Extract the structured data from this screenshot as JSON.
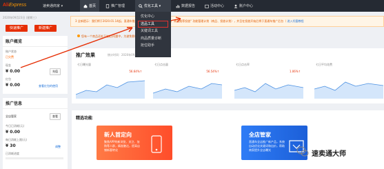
{
  "brand": {
    "logo_main": "Ali",
    "logo_sub": "Express"
  },
  "switcher": "速卖通商家 ▾",
  "nav": {
    "home": "首页",
    "promo_mgmt": "推广管理",
    "optimize": "优化工具 ▾",
    "data_report": "数据报告",
    "events": "活动中心",
    "account": "账户中心"
  },
  "dropdown": {
    "items": [
      "优化中心",
      "选品工具",
      "关键词工具",
      "商品质量诊断",
      "抢位助手"
    ]
  },
  "notice": {
    "text": "3 全新提示：我们将于2020.01.14起，直通车推广计划内的商品 将逐渐替换为 \"商品推荐投放\" 功能管理计划（商品、投放计划），并且在投放开始后将于直通车推广后台（",
    "link": "进入托管教程",
    "text2": "您有一个商品还处于被拒/问题中，为避免影响推广效果，请尽快处理"
  },
  "left": {
    "date": "2020年09月23日 (星期三)",
    "btn_promote": "快速推广",
    "btn_new": "新建推广",
    "overview_title": "账户概览",
    "status_label": "账户状态",
    "status_value": "已欠费",
    "cash_label": "现金",
    "cash_value": "¥ 0.00",
    "recharge": "充值",
    "bonus_label": "红包",
    "bonus_value": "¥ 0.00",
    "bonus_link": "查看红包的使用",
    "info_title": "推广信息",
    "all_label": "全店管家",
    "all_btn": "查看",
    "today_label": "今日已消耗(元)",
    "today_value": "¥ 0.00",
    "budget_label": "每日消耗上限(元)",
    "budget_value": "¥ 30",
    "budget_link": "调整",
    "prog_label": "已消耗进度"
  },
  "effect": {
    "title": "推广效果",
    "subtitle": "统计时间：2020年09月15日~2020",
    "cards": [
      {
        "label": "七日曝光量",
        "value": "",
        "pct": "56.64%↑"
      },
      {
        "label": "七日点击量",
        "value": "",
        "pct": "56.54%↑"
      },
      {
        "label": "七日点击率",
        "value": "",
        "pct": "1.06%↑"
      },
      {
        "label": "七日平均花费",
        "value": "",
        "pct": ""
      }
    ]
  },
  "tools": {
    "title": "精选功能",
    "card1": {
      "title": "新人首定向",
      "desc": "聚焦APP的新浏览、关注、加购等人群，精准触达，提高店铺新客转化"
    },
    "card2": {
      "title": "全店管家",
      "desc": "直通车全店推广新产品，系统自动优化关键词和出价，帮助商家提升全店曝光"
    }
  },
  "watermark": "速卖通大师",
  "colors": {
    "accent": "#e62e04",
    "nav_bg": "#252a33",
    "link": "#1a6fd8"
  }
}
